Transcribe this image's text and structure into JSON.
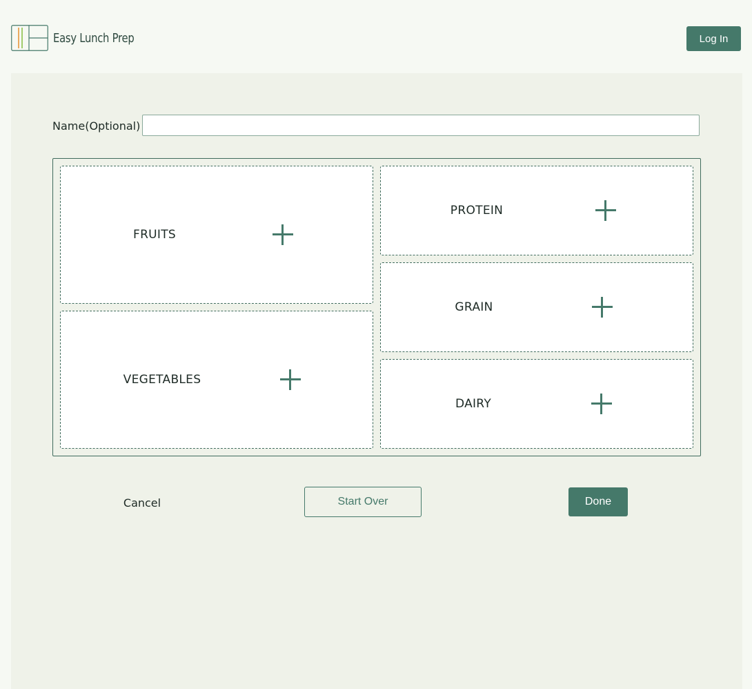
{
  "header": {
    "logo_text": "Easy Lunch Prep",
    "login_label": "Log In"
  },
  "form": {
    "name_label": "Name(Optional)",
    "name_value": "",
    "name_placeholder": ""
  },
  "tray": {
    "fruits": "FRUITS",
    "vegetables": "VEGETABLES",
    "protein": "PROTEIN",
    "grain": "GRAIN",
    "dairy": "DAIRY"
  },
  "actions": {
    "cancel_label": "Cancel",
    "start_over_label": "Start Over",
    "done_label": "Done"
  },
  "icons": {
    "add": "plus-icon",
    "logo": "lunch-tray-logo-icon"
  },
  "colors": {
    "accent": "#45796a",
    "page_bg": "#f6f9f3",
    "panel_bg": "#eff2e9",
    "logo_orange": "#e8953a",
    "logo_green": "#8cc04a"
  }
}
